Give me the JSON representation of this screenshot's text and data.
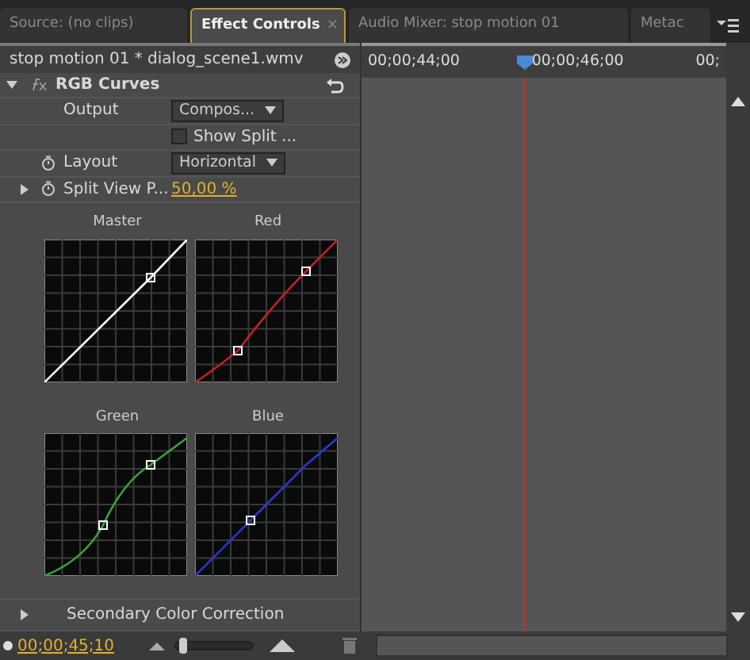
{
  "tabs": [
    {
      "label": "Source: (no clips)",
      "selected": false,
      "closable": false
    },
    {
      "label": "Effect Controls",
      "selected": true,
      "closable": true
    },
    {
      "label": "Audio Mixer: stop motion 01",
      "selected": false,
      "closable": false
    },
    {
      "label": "Metac",
      "selected": false,
      "closable": false
    }
  ],
  "close_mark": "×",
  "clip_header": "stop motion 01 * dialog_scene1.wmv",
  "ruler": [
    "00;00;44;00",
    "00;00;46;00",
    "00;"
  ],
  "effect": {
    "name": "RGB Curves",
    "expanded": true
  },
  "params": [
    {
      "kind": "dropdown",
      "label": "Output",
      "value": "Compos..."
    },
    {
      "kind": "checkbox",
      "label": "Show Split ...",
      "checked": false
    },
    {
      "kind": "dropdown",
      "label": "Layout",
      "value": "Horizontal",
      "stopwatch": true
    },
    {
      "kind": "value",
      "label": "Split View P...",
      "value": "50,00 %",
      "stopwatch": true,
      "expanded": false
    }
  ],
  "curves": [
    {
      "label": "Master",
      "color": "#ffffff"
    },
    {
      "label": "Red",
      "color": "#c0202a"
    },
    {
      "label": "Green",
      "color": "#3aa83a"
    },
    {
      "label": "Blue",
      "color": "#2a3ad0"
    }
  ],
  "secondary": {
    "label": "Secondary Color Correction",
    "expanded": false
  },
  "timecode": "00;00;45;10",
  "zoom": {
    "level": 0.05
  }
}
